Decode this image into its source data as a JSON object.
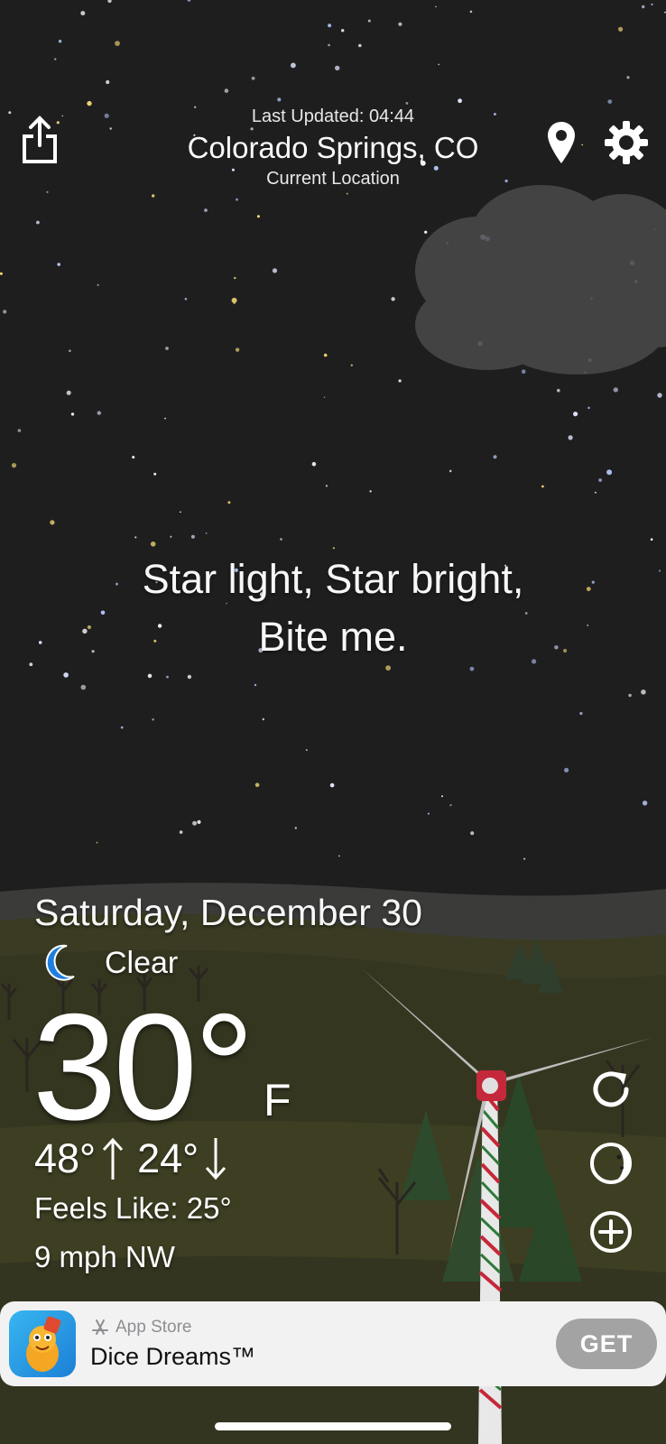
{
  "header": {
    "last_updated": "Last Updated: 04:44",
    "city": "Colorado Springs, CO",
    "location_label": "Current Location"
  },
  "quote": {
    "line1": "Star light, Star bright,",
    "line2": "Bite me."
  },
  "weather": {
    "date": "Saturday, December 30",
    "condition": "Clear",
    "condition_icon": "moon-icon",
    "temperature": "30°",
    "unit": "F",
    "high": "48°",
    "low": "24°",
    "feels_like": "Feels Like: 25°",
    "wind": "9 mph NW"
  },
  "actions": {
    "share": "share-icon",
    "location": "location-pin-icon",
    "settings": "gear-icon",
    "refresh": "refresh-icon",
    "radar": "moon-phase-icon",
    "add": "add-icon"
  },
  "ad": {
    "source": "App Store",
    "title": "Dice Dreams™",
    "button": "GET"
  },
  "colors": {
    "sky": "#1e1e1f",
    "hills": "#3a3b22",
    "turbine_hub": "#c5283a",
    "moon": "#1f7fe0"
  }
}
